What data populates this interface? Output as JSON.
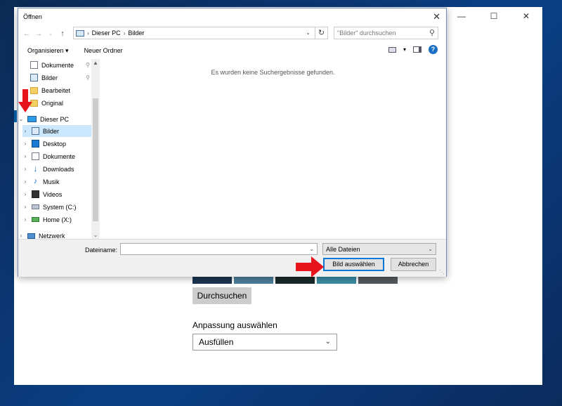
{
  "settings": {
    "browse_label": "Durchsuchen",
    "fit_label": "Anpassung auswählen",
    "fit_value": "Ausfüllen",
    "thumb_colors": [
      "#1b3552",
      "#4d7f9b",
      "#1a2a2a",
      "#3b8da5",
      "#555a5e"
    ]
  },
  "dialog": {
    "title": "Öffnen",
    "address": {
      "crumbs": [
        "Dieser PC",
        "Bilder"
      ]
    },
    "search_placeholder": "\"Bilder\" durchsuchen",
    "toolbar": {
      "organize": "Organisieren",
      "new_folder": "Neuer Ordner"
    },
    "nav": {
      "quick": [
        {
          "label": "Dokumente",
          "icon": "document-icon",
          "pinned": true
        },
        {
          "label": "Bilder",
          "icon": "pictures-icon",
          "pinned": true
        },
        {
          "label": "Bearbeitet",
          "icon": "folder-icon",
          "pinned": false
        },
        {
          "label": "Original",
          "icon": "folder-icon",
          "pinned": false
        }
      ],
      "this_pc": "Dieser PC",
      "pc_items": [
        {
          "label": "Bilder",
          "icon": "pictures-icon",
          "selected": true
        },
        {
          "label": "Desktop",
          "icon": "desktop-icon"
        },
        {
          "label": "Dokumente",
          "icon": "document-icon"
        },
        {
          "label": "Downloads",
          "icon": "download-icon"
        },
        {
          "label": "Musik",
          "icon": "music-icon"
        },
        {
          "label": "Videos",
          "icon": "video-icon"
        },
        {
          "label": "System (C:)",
          "icon": "drive-icon"
        },
        {
          "label": "Home (X:)",
          "icon": "network-drive-icon"
        }
      ],
      "network": "Netzwerk"
    },
    "empty_message": "Es wurden keine Suchergebnisse gefunden.",
    "filename_label": "Dateiname:",
    "filename_value": "",
    "filter_value": "Alle Dateien",
    "ok_label": "Bild auswählen",
    "cancel_label": "Abbrechen"
  },
  "colors": {
    "accent": "#0078d7",
    "selection": "#cce8ff",
    "arrow": "#e8141c"
  }
}
